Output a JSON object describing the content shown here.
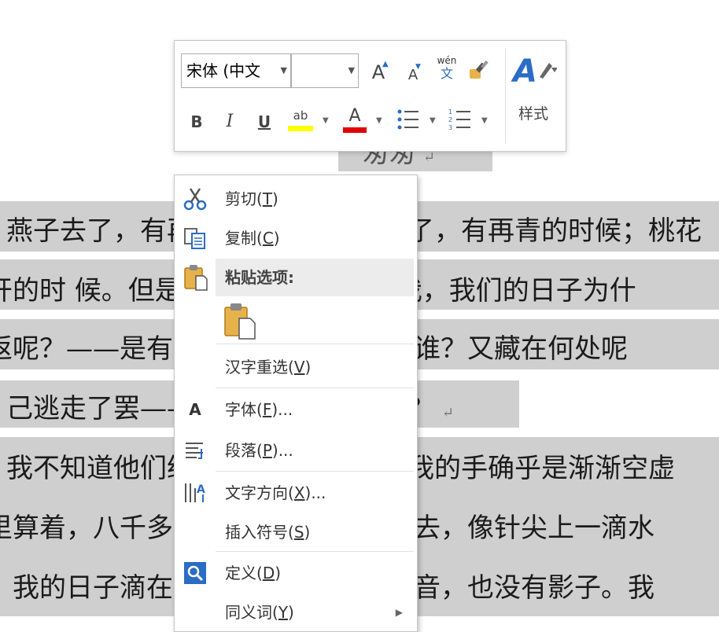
{
  "document": {
    "title_text": "匆匆",
    "lines": [
      "燕子去了，有再来的时候；杨柳枯了，有再青的时候；桃花",
      "开的时  候。但是，聪明的，你告诉我，我们的日子为什",
      "返呢？——是有人偷了他们罢：那是谁？又藏在何处呢",
      "己逃走了罢——如今又到了哪里呢？",
      "我不知道他们给了我多少日子；但我的手确乎是渐渐空虚",
      "里算着，八千多日子已经从我手中溜去，像针尖上一滴水",
      "，我的日子滴在时间的流里，没有声音，也没有影子。我"
    ]
  },
  "mini_toolbar": {
    "font_name": "宋体 (中文",
    "font_size": "",
    "grow_font": "A",
    "shrink_font": "A",
    "phonetic_top": "wén",
    "phonetic_bottom": "文",
    "bold": "B",
    "italic": "I",
    "underline": "U",
    "highlight": "ab",
    "font_color": "A",
    "styles_label": "样式",
    "highlight_color": "#ffff00",
    "font_color_bar": "#e00000"
  },
  "context_menu": {
    "items": [
      {
        "label": "剪切",
        "key": "T"
      },
      {
        "label": "复制",
        "key": "C"
      },
      {
        "label": "粘贴选项:"
      },
      {
        "label": "汉字重选",
        "key": "V"
      },
      {
        "label": "字体",
        "key": "F",
        "suffix": "..."
      },
      {
        "label": "段落",
        "key": "P",
        "suffix": "..."
      },
      {
        "label": "文字方向",
        "key": "X",
        "suffix": "..."
      },
      {
        "label": "插入符号",
        "key": "S"
      },
      {
        "label": "定义",
        "key": "D"
      },
      {
        "label": "同义词",
        "key": "Y"
      }
    ]
  }
}
